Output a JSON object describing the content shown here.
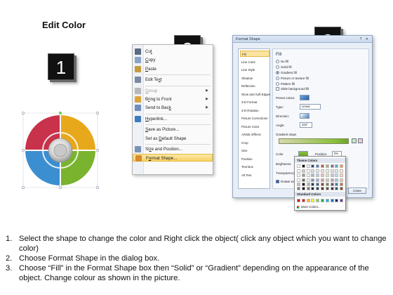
{
  "heading": "Edit Color",
  "badges": [
    "1",
    "2",
    "3"
  ],
  "context_menu": {
    "items": [
      {
        "label": "Cut",
        "underline": "t",
        "enabled": true,
        "submenu": false,
        "icon": "scissors-icon"
      },
      {
        "label": "Copy",
        "underline": "C",
        "enabled": true,
        "submenu": false,
        "icon": "copy-icon"
      },
      {
        "label": "Paste",
        "underline": "P",
        "enabled": true,
        "submenu": false,
        "icon": "paste-icon"
      },
      {
        "label": "Edit Text",
        "underline": "x",
        "enabled": true,
        "submenu": false,
        "icon": "edit-text-icon"
      },
      {
        "label": "Group",
        "underline": "G",
        "enabled": false,
        "submenu": true,
        "icon": "group-icon"
      },
      {
        "label": "Bring to Front",
        "underline": "r",
        "enabled": true,
        "submenu": true,
        "icon": "bring-front-icon"
      },
      {
        "label": "Send to Back",
        "underline": "k",
        "enabled": true,
        "submenu": true,
        "icon": "send-back-icon"
      },
      {
        "label": "Hyperlink...",
        "underline": "H",
        "enabled": true,
        "submenu": false,
        "icon": "hyperlink-icon"
      },
      {
        "label": "Save as Picture...",
        "underline": "S",
        "enabled": true,
        "submenu": false,
        "icon": ""
      },
      {
        "label": "Set as Default Shape",
        "underline": "D",
        "enabled": true,
        "submenu": false,
        "icon": ""
      },
      {
        "label": "Size and Position...",
        "underline": "z",
        "enabled": true,
        "submenu": false,
        "icon": "size-position-icon"
      },
      {
        "label": "Format Shape...",
        "underline": "o",
        "enabled": true,
        "submenu": false,
        "icon": "format-shape-icon",
        "highlighted": true
      }
    ]
  },
  "dialog": {
    "title": "Format Shape",
    "title_buttons": "? ✕",
    "nav": [
      "Fill",
      "Line Color",
      "Line Style",
      "Shadow",
      "Reflection",
      "Glow and Soft Edges",
      "3-D Format",
      "3-D Rotation",
      "Picture Corrections",
      "Picture Color",
      "Artistic Effects",
      "Crop",
      "Size",
      "Position",
      "Text Box",
      "Alt Text"
    ],
    "pane_title": "Fill",
    "fill_options": [
      {
        "label": "No fill",
        "selected": false
      },
      {
        "label": "Solid fill",
        "selected": false
      },
      {
        "label": "Gradient fill",
        "selected": true
      },
      {
        "label": "Picture or texture fill",
        "selected": false
      },
      {
        "label": "Pattern fill",
        "selected": false
      }
    ],
    "slide_background": "Slide background fill",
    "preset_colors_label": "Preset colors:",
    "type_label": "Type:",
    "type_value": "Linear",
    "direction_label": "Direction:",
    "angle_label": "Angle:",
    "angle_value": "315°",
    "gradient_stops_label": "Gradient stops",
    "color_label": "Color",
    "position_label": "Position:",
    "position_value": "0%",
    "brightness_label": "Brightness:",
    "transparency_label": "Transparency:",
    "rotate_label": "Rotate with shape",
    "close_label": "Close"
  },
  "palette": {
    "theme_header": "Theme Colors",
    "standard_header": "Standard Colors",
    "more": "More Colors...",
    "theme_top": [
      "#ffffff",
      "#000000",
      "#eeece1",
      "#1f497d",
      "#4f81bd",
      "#c0504d",
      "#9bbb59",
      "#8064a2",
      "#4bacc6",
      "#f79646"
    ],
    "standard": [
      "#c00000",
      "#ff0000",
      "#ffc000",
      "#ffff00",
      "#92d050",
      "#00b050",
      "#00b0f0",
      "#0070c0",
      "#002060",
      "#7030a0"
    ]
  },
  "donut": {
    "colors": [
      "#c8324a",
      "#e8a81c",
      "#3b8fd1",
      "#7ab32e"
    ]
  },
  "instructions": [
    {
      "num": "1.",
      "text": "Select the shape to change the color and Right click the object( click any object which you want to change color)"
    },
    {
      "num": "2.",
      "text": "Choose Format Shape in the dialog box."
    },
    {
      "num": "3.",
      "text": "Choose “Fill” in the Format Shape box then “Solid” or “Gradient” depending on the appearance of the object. Change colour as shown in the picture."
    }
  ]
}
